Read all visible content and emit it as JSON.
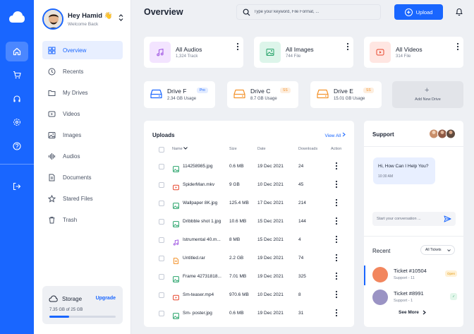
{
  "user": {
    "name": "Hey Hamid 👋",
    "subtitle": "Welcome Back"
  },
  "rail": {
    "icons": [
      "cloud-logo-icon",
      "home-icon",
      "cart-icon",
      "headphones-icon",
      "settings-icon",
      "help-icon",
      "logout-icon"
    ]
  },
  "nav": [
    {
      "label": "Overview",
      "icon": "grid-icon",
      "active": true
    },
    {
      "label": "Recents",
      "icon": "clock-icon"
    },
    {
      "label": "My Drives",
      "icon": "folder-icon"
    },
    {
      "label": "Videos",
      "icon": "video-icon"
    },
    {
      "label": "Images",
      "icon": "image-icon"
    },
    {
      "label": "Audios",
      "icon": "audio-icon"
    },
    {
      "label": "Documents",
      "icon": "document-icon"
    },
    {
      "label": "Stared Files",
      "icon": "star-icon"
    },
    {
      "label": "Trash",
      "icon": "trash-icon"
    }
  ],
  "storage": {
    "title": "Storage",
    "upgrade": "Upgrade",
    "usage": "7.35 GB of 25 GB",
    "fraction": 0.294
  },
  "header": {
    "title": "Overview",
    "search_placeholder": "Type your keyword, File Format, ...",
    "upload_label": "Upload"
  },
  "categories": [
    {
      "name": "All Audios",
      "count": "1,324 Track",
      "color": "#f3e4ff"
    },
    {
      "name": "All Images",
      "count": "744 File",
      "color": "#ddf5ea"
    },
    {
      "name": "All Videos",
      "count": "314 File",
      "color": "#ffe6e2"
    }
  ],
  "drives": [
    {
      "name": "Drive F",
      "usage": "2.34 GB Usage",
      "badge": "Pro",
      "color": "#1966ff"
    },
    {
      "name": "Drive C",
      "usage": "8.7 GB Usage",
      "badge": "SS",
      "color": "#f3922b"
    },
    {
      "name": "Drive E",
      "usage": "15.01 GB Usage",
      "badge": "SS",
      "color": "#f3922b"
    }
  ],
  "add_drive": "Add New Drive",
  "uploads": {
    "title": "Uploads",
    "view_all": "View All",
    "columns": {
      "name": "Name",
      "size": "Size",
      "date": "Date",
      "downloads": "Downloads",
      "action": "Action"
    },
    "rows": [
      {
        "name": "114258985.jpg",
        "size": "0.6 MB",
        "date": "19 Dec 2021",
        "downloads": "24",
        "type": "image"
      },
      {
        "name": "SpiderMan.mkv",
        "size": "9 GB",
        "date": "10 Dec 2021",
        "downloads": "45",
        "type": "video"
      },
      {
        "name": "Wallpaper 8K.jpg",
        "size": "125.4 MB",
        "date": "17 Dec 2021",
        "downloads": "214",
        "type": "image"
      },
      {
        "name": "Dribbble shot 1.jpg",
        "size": "10.6 MB",
        "date": "15 Dec 2021",
        "downloads": "144",
        "type": "image"
      },
      {
        "name": "Istrumental 40.m...",
        "size": "8 MB",
        "date": "15 Dec 2021",
        "downloads": "4",
        "type": "audio"
      },
      {
        "name": "Untitled.rar",
        "size": "2.2 GB",
        "date": "19 Dec 2021",
        "downloads": "74",
        "type": "archive"
      },
      {
        "name": "Frame 42731818...",
        "size": "7.01 MB",
        "date": "19 Dec 2021",
        "downloads": "325",
        "type": "image"
      },
      {
        "name": "Sm-teaser.mp4",
        "size": "970.6 MB",
        "date": "10 Dec 2021",
        "downloads": "8",
        "type": "video"
      },
      {
        "name": "Sm- poster.jpg",
        "size": "0.6 MB",
        "date": "19 Dec 2021",
        "downloads": "31",
        "type": "image"
      }
    ]
  },
  "support": {
    "title": "Support",
    "message": "Hi, How Can I Help You?",
    "message_time": "10:30 AM",
    "input_placeholder": "Start your conversation ...",
    "recent_title": "Recent",
    "filter": "All Tickets",
    "tickets": [
      {
        "name": "Ticket #10504",
        "sub": "Support - 11",
        "status": "Open",
        "color": "#f2865e"
      },
      {
        "name": "Ticket #8991",
        "sub": "Support - 1",
        "status": "✓",
        "color": "#9a93c4"
      }
    ],
    "see_more": "See More"
  }
}
